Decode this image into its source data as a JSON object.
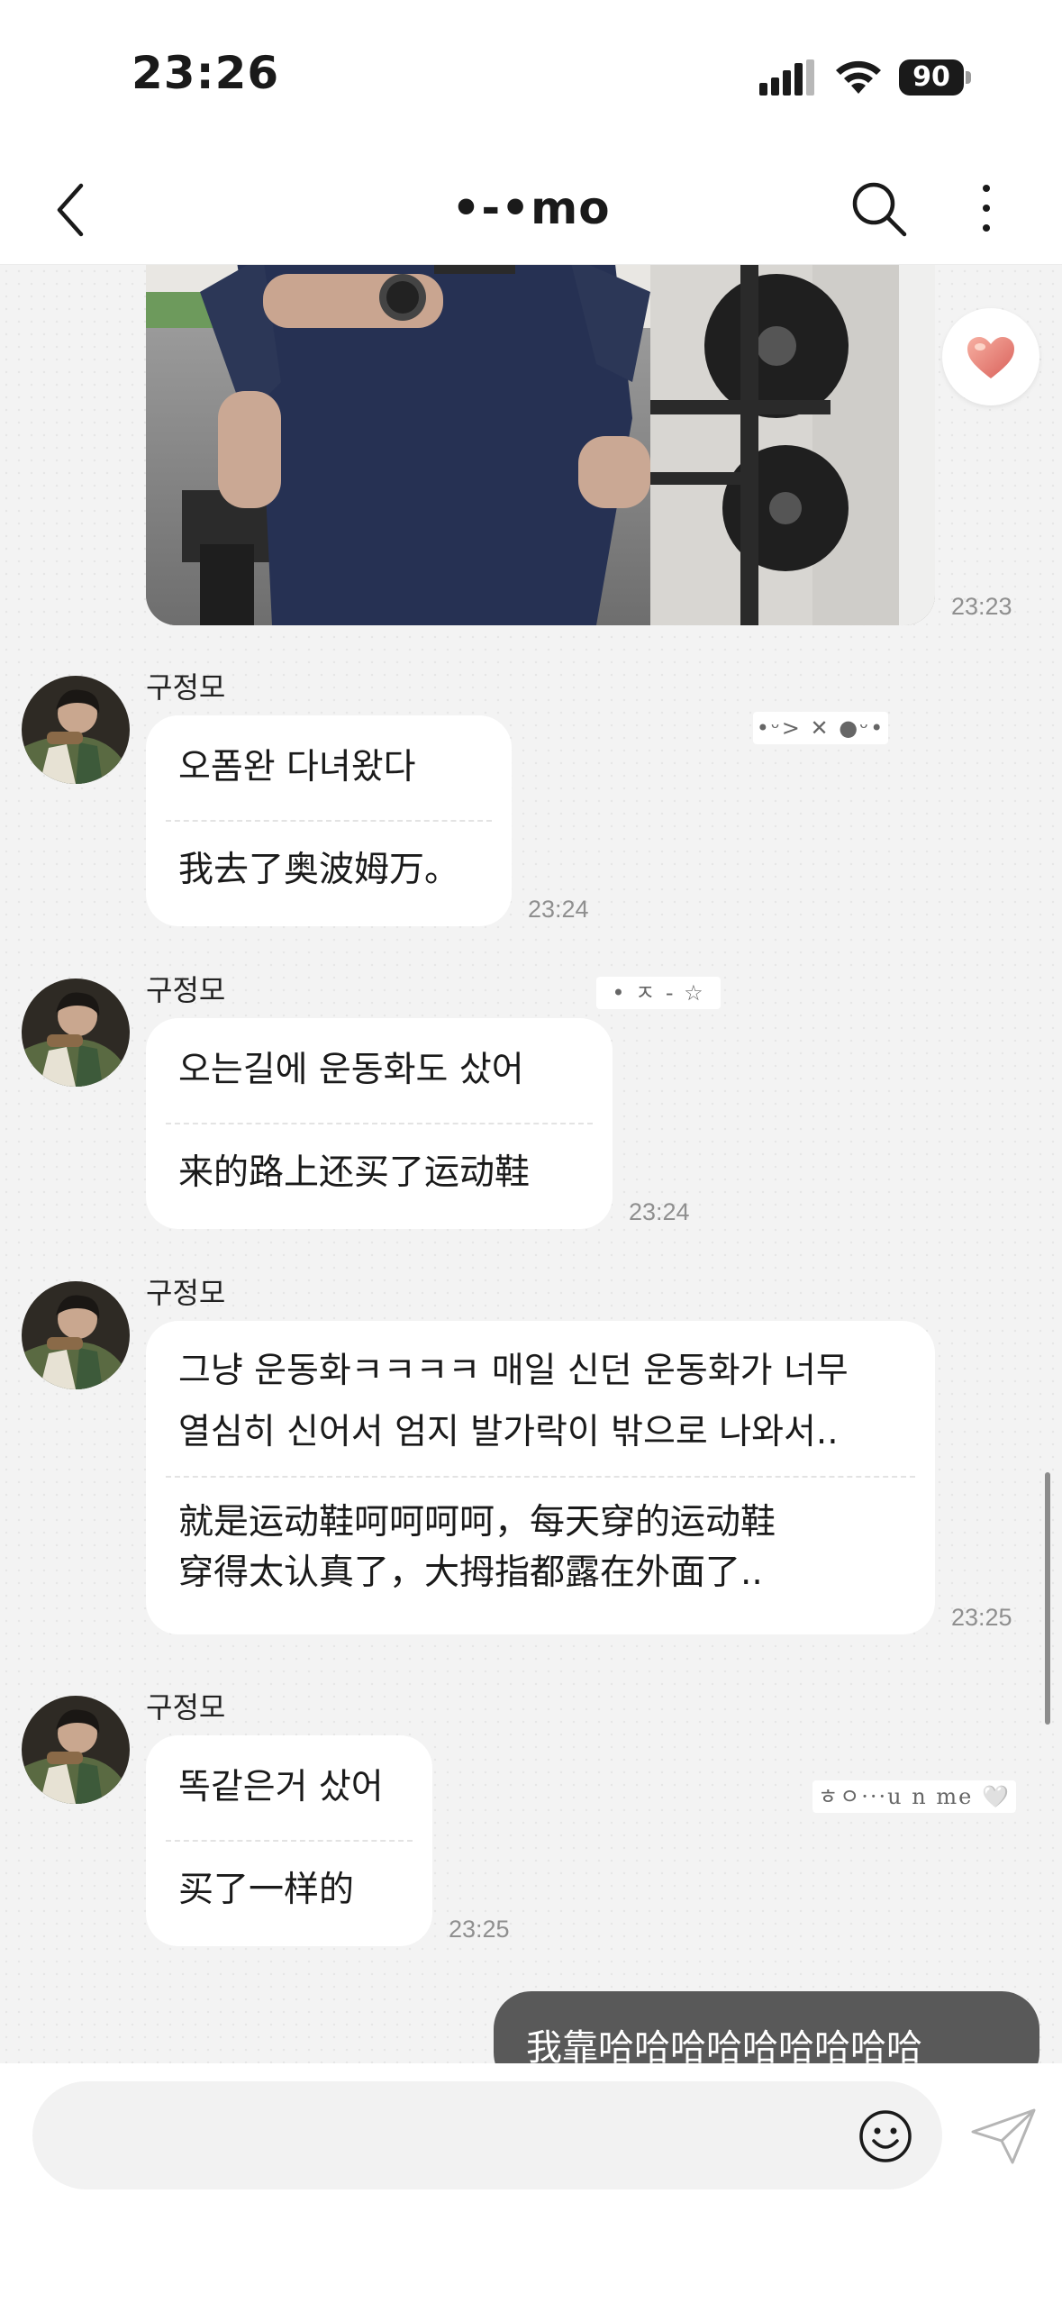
{
  "status_bar": {
    "time": "23:26",
    "battery": "90"
  },
  "header": {
    "title": "•-•mo"
  },
  "photo": {
    "timestamp": "23:23"
  },
  "messages": [
    {
      "sender": "구정모",
      "segments": [
        "오폼완 다녀왔다",
        "我去了奥波姆万。"
      ],
      "timestamp": "23:24",
      "sticker": "•ᵕ> ✕ ●ᵕ•"
    },
    {
      "sender": "구정모",
      "segments": [
        "오는길에 운동화도 샀어",
        "来的路上还买了运动鞋"
      ],
      "timestamp": "23:24",
      "sticker": "• ㅈ - ☆"
    },
    {
      "sender": "구정모",
      "segments": [
        [
          "그냥 운동화ㅋㅋㅋㅋ 매일 신던 운동화가 너무",
          "열심히 신어서 엄지 발가락이 밖으로 나와서.."
        ],
        [
          "就是运动鞋呵呵呵呵，每天穿的运动鞋",
          "穿得太认真了，大拇指都露在外面了.."
        ]
      ],
      "timestamp": "23:25"
    },
    {
      "sender": "구정모",
      "segments": [
        "똑같은거 샀어",
        "买了一样的"
      ],
      "timestamp": "23:25",
      "sticker": "ㅎㅇ···u n me 🤍"
    }
  ],
  "my_message": {
    "text": "我靠哈哈哈哈哈哈哈哈哈"
  },
  "input": {
    "placeholder": ""
  }
}
